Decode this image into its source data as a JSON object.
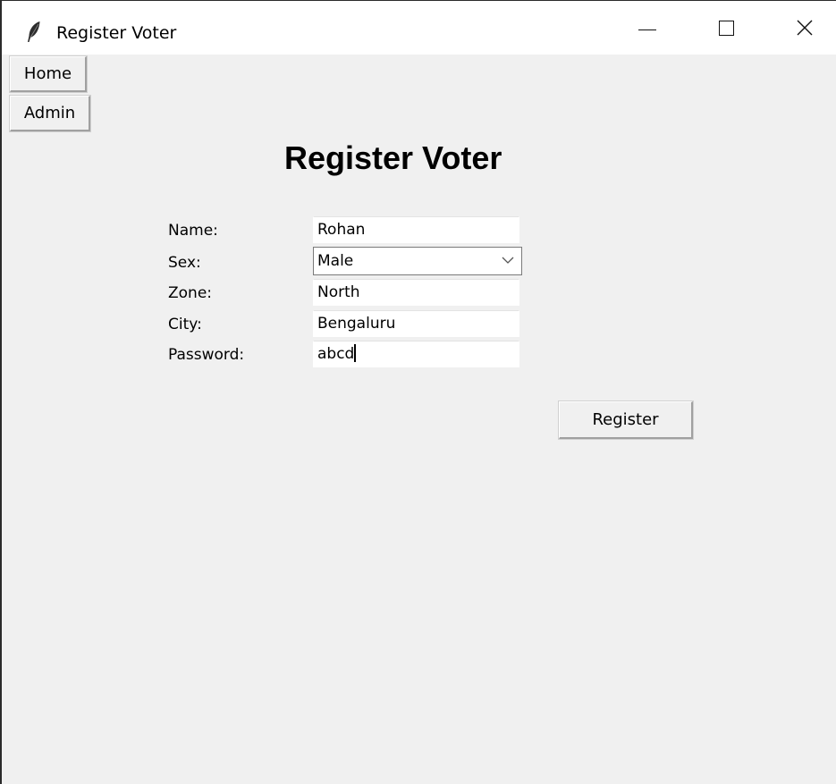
{
  "window": {
    "title": "Register Voter"
  },
  "nav": {
    "home_label": "Home",
    "admin_label": "Admin"
  },
  "form": {
    "heading": "Register Voter",
    "name_label": "Name:",
    "name_value": "Rohan",
    "sex_label": "Sex:",
    "sex_value": "Male",
    "zone_label": "Zone:",
    "zone_value": "North",
    "city_label": "City:",
    "city_value": "Bengaluru",
    "password_label": "Password:",
    "password_value": "abcd",
    "register_label": "Register"
  },
  "icons": {
    "app": "feather-icon",
    "minimize": "minimize-icon",
    "maximize": "maximize-icon",
    "close": "close-icon",
    "dropdown": "chevron-down-icon"
  },
  "colors": {
    "background": "#f0f0f0",
    "titlebar": "#ffffff",
    "entry": "#ffffff"
  }
}
